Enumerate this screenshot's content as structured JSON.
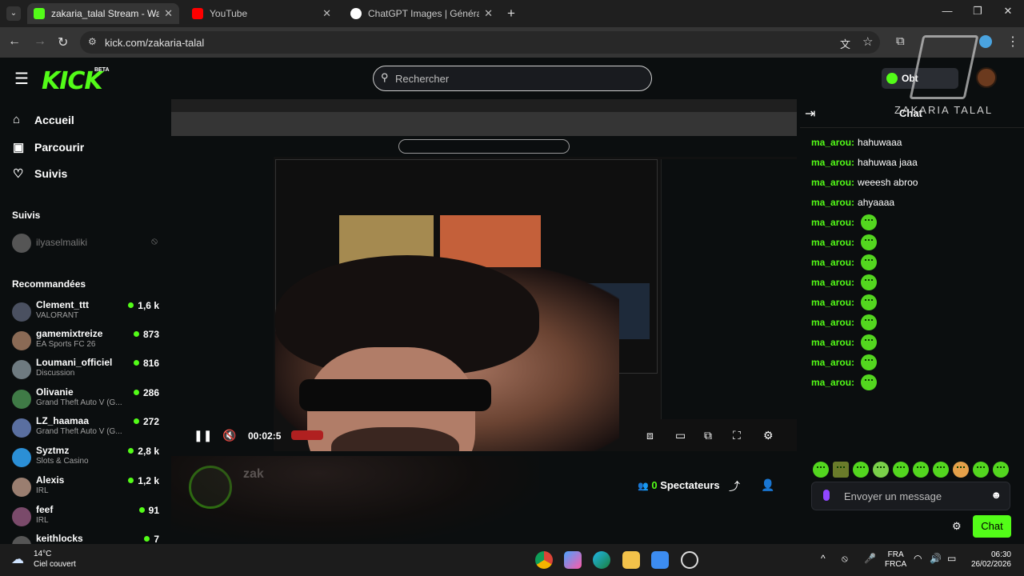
{
  "browser": {
    "tabs": [
      {
        "label": "zakaria_talal Stream - Watch Li",
        "active": true,
        "color": "#53fc18"
      },
      {
        "label": "YouTube",
        "active": false,
        "color": "#ff0000"
      },
      {
        "label": "ChatGPT Images | Générateur d",
        "active": false,
        "color": "#ffffff"
      }
    ],
    "url": "kick.com/zakaria-talal"
  },
  "kick": {
    "logo": "KICK",
    "logo_badge": "BETA",
    "search_placeholder": "Rechercher",
    "get_button": "Obt"
  },
  "sidebar": {
    "nav": [
      {
        "label": "Accueil",
        "icon": "home-icon"
      },
      {
        "label": "Parcourir",
        "icon": "browse-icon"
      },
      {
        "label": "Suivis",
        "icon": "heart-icon"
      }
    ],
    "followed_heading": "Suivis",
    "followed": [
      {
        "name": "ilyaselmaliki"
      }
    ],
    "recommended_heading": "Recommandées",
    "recommended": [
      {
        "name": "Clement_ttt",
        "category": "VALORANT",
        "viewers": "1,6 k"
      },
      {
        "name": "gamemixtreize",
        "category": "EA Sports FC 26",
        "viewers": "873"
      },
      {
        "name": "Loumani_officiel",
        "category": "Discussion",
        "viewers": "816"
      },
      {
        "name": "Olivanie",
        "category": "Grand Theft Auto V (G...",
        "viewers": "286"
      },
      {
        "name": "LZ_haamaa",
        "category": "Grand Theft Auto V (G...",
        "viewers": "272"
      },
      {
        "name": "Syztmz",
        "category": "Slots & Casino",
        "viewers": "2,8 k"
      },
      {
        "name": "Alexis",
        "category": "IRL",
        "viewers": "1,2 k"
      },
      {
        "name": "feef",
        "category": "IRL",
        "viewers": "91"
      },
      {
        "name": "keithlocks",
        "category": "",
        "viewers": "7"
      }
    ]
  },
  "player": {
    "time": "00:02:5"
  },
  "channel": {
    "name": "zak",
    "spectators_count": "0",
    "spectators_label": "Spectateurs"
  },
  "chat": {
    "title": "Chat",
    "watermark": "ZAKARIA TALAL",
    "messages": [
      {
        "user": "ma_arou:",
        "text": "hahuwaaa",
        "emote": false
      },
      {
        "user": "ma_arou:",
        "text": "hahuwaa jaaa",
        "emote": false
      },
      {
        "user": "ma_arou:",
        "text": "weeesh abroo",
        "emote": false
      },
      {
        "user": "ma_arou:",
        "text": "ahyaaaa",
        "emote": false
      },
      {
        "user": "ma_arou:",
        "text": "",
        "emote": true
      },
      {
        "user": "ma_arou:",
        "text": "",
        "emote": true
      },
      {
        "user": "ma_arou:",
        "text": "",
        "emote": true
      },
      {
        "user": "ma_arou:",
        "text": "",
        "emote": true
      },
      {
        "user": "ma_arou:",
        "text": "",
        "emote": true
      },
      {
        "user": "ma_arou:",
        "text": "",
        "emote": true
      },
      {
        "user": "ma_arou:",
        "text": "",
        "emote": true
      },
      {
        "user": "ma_arou:",
        "text": "",
        "emote": true
      },
      {
        "user": "ma_arou:",
        "text": "",
        "emote": true
      }
    ],
    "input_placeholder": "Envoyer un message",
    "send_label": "Chat",
    "accent": "#53fc18"
  },
  "taskbar": {
    "temp": "14°C",
    "weather": "Ciel couvert",
    "lang1": "FRA",
    "lang2": "FRCA",
    "time": "06:30",
    "date": "26/02/2026"
  }
}
